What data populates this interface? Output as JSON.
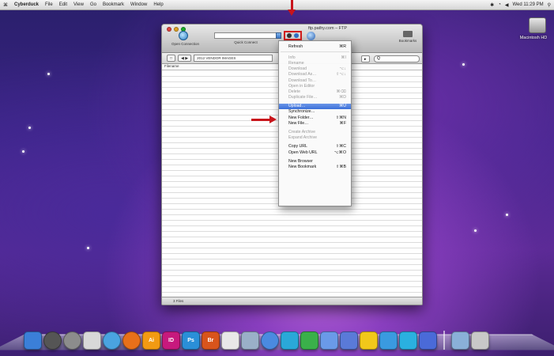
{
  "menubar": {
    "apple": "⌘",
    "app_name": "Cyberduck",
    "items": [
      "File",
      "Edit",
      "View",
      "Go",
      "Bookmark",
      "Window",
      "Help"
    ],
    "clock": "Wed 11:29 PM"
  },
  "desktop": {
    "hd_label": "Macintosh HD"
  },
  "window": {
    "title": "ftp.pathy.com – FTP",
    "toolbar": {
      "open_connection": "Open Connection",
      "quick_connect": "Quick Connect",
      "bookmarks": "Bookmarks"
    },
    "path": "2012 VENDOR IMAGES",
    "column_header": "Filename",
    "status": "3 Files",
    "search_placeholder": "Q"
  },
  "menu": {
    "items": [
      {
        "label": "Refresh",
        "shortcut": "⌘R",
        "state": "enabled"
      },
      {
        "sep": true
      },
      {
        "label": "Info",
        "shortcut": "⌘I",
        "state": "disabled"
      },
      {
        "label": "Rename",
        "shortcut": "",
        "state": "disabled"
      },
      {
        "label": "Download",
        "shortcut": "⌥↓",
        "state": "disabled"
      },
      {
        "label": "Download As…",
        "shortcut": "⇧⌥↓",
        "state": "disabled"
      },
      {
        "label": "Download To…",
        "shortcut": "",
        "state": "disabled"
      },
      {
        "label": "Open in Editor",
        "shortcut": "",
        "state": "disabled"
      },
      {
        "label": "Delete",
        "shortcut": "⌘⌫",
        "state": "disabled"
      },
      {
        "label": "Duplicate File…",
        "shortcut": "⌘D",
        "state": "disabled"
      },
      {
        "gap": true
      },
      {
        "label": "Upload…",
        "shortcut": "⌘U",
        "state": "selected"
      },
      {
        "label": "Synchronize…",
        "shortcut": "",
        "state": "enabled"
      },
      {
        "label": "New Folder…",
        "shortcut": "⇧⌘N",
        "state": "enabled"
      },
      {
        "label": "New File…",
        "shortcut": "⌘F",
        "state": "enabled"
      },
      {
        "gap": true
      },
      {
        "label": "Create Archive",
        "shortcut": "",
        "state": "disabled"
      },
      {
        "label": "Expand Archive",
        "shortcut": "",
        "state": "disabled"
      },
      {
        "gap": true
      },
      {
        "label": "Copy URL",
        "shortcut": "⇧⌘C",
        "state": "enabled"
      },
      {
        "label": "Open Web URL",
        "shortcut": "⌥⌘O",
        "state": "enabled"
      },
      {
        "gap": true
      },
      {
        "label": "New Browser",
        "shortcut": "",
        "state": "enabled"
      },
      {
        "label": "New Bookmark",
        "shortcut": "⇧⌘B",
        "state": "enabled"
      }
    ]
  },
  "dock": {
    "icons": [
      {
        "name": "finder-icon",
        "color": "#3b7fd8",
        "text": ""
      },
      {
        "name": "dashboard-icon",
        "color": "#555555",
        "text": ""
      },
      {
        "name": "system-preferences-icon",
        "color": "#8c8c8c",
        "text": ""
      },
      {
        "name": "ical-icon",
        "color": "#d8d8d8",
        "text": ""
      },
      {
        "name": "safari-icon",
        "color": "#4aa3e0",
        "text": ""
      },
      {
        "name": "firefox-icon",
        "color": "#e8701a",
        "text": ""
      },
      {
        "name": "illustrator-icon",
        "color": "#f29a12",
        "text": "Ai"
      },
      {
        "name": "indesign-icon",
        "color": "#c7197d",
        "text": "ID"
      },
      {
        "name": "photoshop-icon",
        "color": "#2a8fd8",
        "text": "Ps"
      },
      {
        "name": "bridge-icon",
        "color": "#d8541c",
        "text": "Br"
      },
      {
        "name": "acrobat-icon",
        "color": "#e8e8e8",
        "text": ""
      },
      {
        "name": "utility-icon",
        "color": "#9ab0c8",
        "text": ""
      },
      {
        "name": "itunes-icon",
        "color": "#4a8ae0",
        "text": ""
      },
      {
        "name": "app-icon-1",
        "color": "#2aa8d8",
        "text": ""
      },
      {
        "name": "app-icon-2",
        "color": "#3ab04a",
        "text": ""
      },
      {
        "name": "app-icon-3",
        "color": "#6a9ae8",
        "text": ""
      },
      {
        "name": "app-icon-4",
        "color": "#5a7ad8",
        "text": ""
      },
      {
        "name": "cyberduck-icon",
        "color": "#f2c81a",
        "text": ""
      },
      {
        "name": "app-icon-5",
        "color": "#3a9ae0",
        "text": ""
      },
      {
        "name": "app-icon-6",
        "color": "#2ab0e0",
        "text": ""
      },
      {
        "name": "app-icon-7",
        "color": "#4a6ad8",
        "text": ""
      },
      {
        "name": "documents-stack-icon",
        "color": "#8ab0d8",
        "text": ""
      },
      {
        "name": "trash-icon",
        "color": "#c8c8c8",
        "text": ""
      }
    ]
  },
  "colors": {
    "highlight": "#c8141b",
    "selection": "#3a6fd9"
  }
}
